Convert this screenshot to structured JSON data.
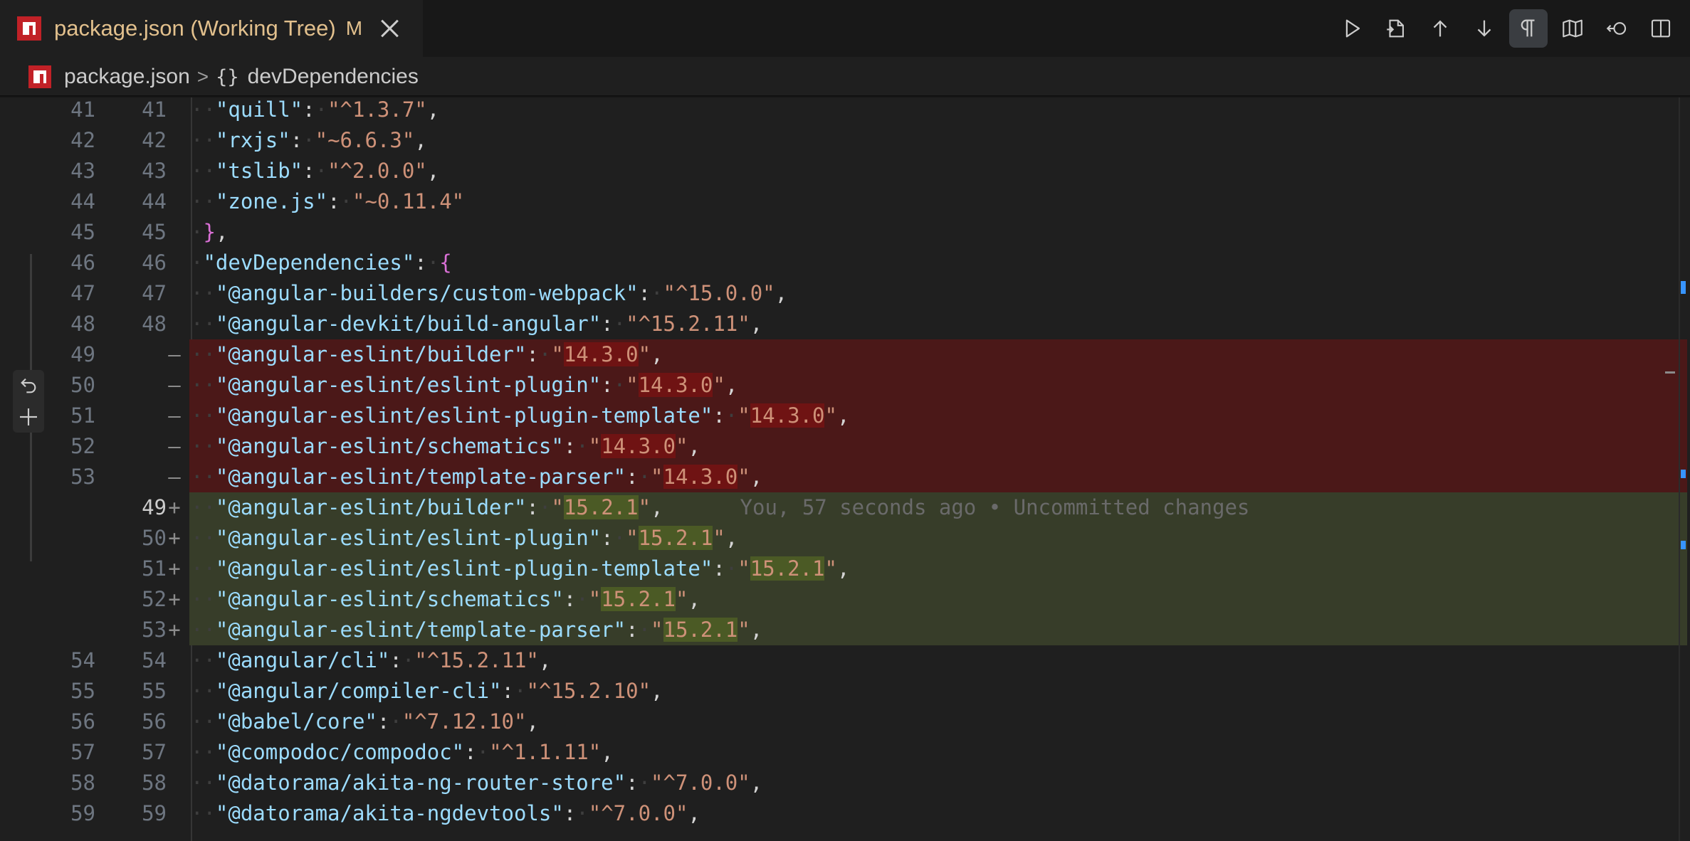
{
  "tab": {
    "title": "package.json (Working Tree)",
    "badge": "M",
    "icon": "npm-icon"
  },
  "toolbar": {
    "buttons": [
      "run-icon",
      "open-file-icon",
      "previous-change-icon",
      "next-change-icon",
      "whitespace-icon",
      "minimap-icon",
      "revert-icon",
      "split-editor-icon"
    ]
  },
  "breadcrumb": {
    "file": "package.json",
    "separator": ">",
    "symbol_icon": "{}",
    "symbol": "devDependencies"
  },
  "editor": {
    "blame": "You, 57 seconds ago • Uncommitted changes",
    "lines": [
      {
        "old": "41",
        "new": "41",
        "mark": "",
        "type": "ctx",
        "indent": 2,
        "key": "\"quill\"",
        "value": "\"^1.3.7\"",
        "trail": ","
      },
      {
        "old": "42",
        "new": "42",
        "mark": "",
        "type": "ctx",
        "indent": 2,
        "key": "\"rxjs\"",
        "value": "\"~6.6.3\"",
        "trail": ","
      },
      {
        "old": "43",
        "new": "43",
        "mark": "",
        "type": "ctx",
        "indent": 2,
        "key": "\"tslib\"",
        "value": "\"^2.0.0\"",
        "trail": ","
      },
      {
        "old": "44",
        "new": "44",
        "mark": "",
        "type": "ctx",
        "indent": 2,
        "key": "\"zone.js\"",
        "value": "\"~0.11.4\"",
        "trail": ""
      },
      {
        "old": "45",
        "new": "45",
        "mark": "",
        "type": "ctx",
        "indent": 1,
        "raw": "}",
        "trail": ","
      },
      {
        "old": "46",
        "new": "46",
        "mark": "",
        "type": "ctx",
        "indent": 1,
        "key": "\"devDependencies\"",
        "open": "{",
        "trail": ""
      },
      {
        "old": "47",
        "new": "47",
        "mark": "",
        "type": "ctx",
        "indent": 2,
        "key": "\"@angular-builders/custom-webpack\"",
        "value": "\"^15.0.0\"",
        "trail": ","
      },
      {
        "old": "48",
        "new": "48",
        "mark": "",
        "type": "ctx",
        "indent": 2,
        "key": "\"@angular-devkit/build-angular\"",
        "value": "\"^15.2.11\"",
        "trail": ","
      },
      {
        "old": "49",
        "new": "",
        "mark": "—",
        "type": "del",
        "indent": 2,
        "key": "\"@angular-eslint/builder\"",
        "value": "\"14.3.0\"",
        "trail": ","
      },
      {
        "old": "50",
        "new": "",
        "mark": "—",
        "type": "del",
        "indent": 2,
        "key": "\"@angular-eslint/eslint-plugin\"",
        "value": "\"14.3.0\"",
        "trail": ","
      },
      {
        "old": "51",
        "new": "",
        "mark": "—",
        "type": "del",
        "indent": 2,
        "key": "\"@angular-eslint/eslint-plugin-template\"",
        "value": "\"14.3.0\"",
        "trail": ","
      },
      {
        "old": "52",
        "new": "",
        "mark": "—",
        "type": "del",
        "indent": 2,
        "key": "\"@angular-eslint/schematics\"",
        "value": "\"14.3.0\"",
        "trail": ","
      },
      {
        "old": "53",
        "new": "",
        "mark": "—",
        "type": "del",
        "indent": 2,
        "key": "\"@angular-eslint/template-parser\"",
        "value": "\"14.3.0\"",
        "trail": ","
      },
      {
        "old": "",
        "new": "49",
        "mark": "+",
        "type": "ins",
        "active": true,
        "indent": 2,
        "key": "\"@angular-eslint/builder\"",
        "value": "\"15.2.1\"",
        "trail": ",",
        "blame": true
      },
      {
        "old": "",
        "new": "50",
        "mark": "+",
        "type": "ins",
        "indent": 2,
        "key": "\"@angular-eslint/eslint-plugin\"",
        "value": "\"15.2.1\"",
        "trail": ","
      },
      {
        "old": "",
        "new": "51",
        "mark": "+",
        "type": "ins",
        "indent": 2,
        "key": "\"@angular-eslint/eslint-plugin-template\"",
        "value": "\"15.2.1\"",
        "trail": ","
      },
      {
        "old": "",
        "new": "52",
        "mark": "+",
        "type": "ins",
        "indent": 2,
        "key": "\"@angular-eslint/schematics\"",
        "value": "\"15.2.1\"",
        "trail": ","
      },
      {
        "old": "",
        "new": "53",
        "mark": "+",
        "type": "ins",
        "indent": 2,
        "key": "\"@angular-eslint/template-parser\"",
        "value": "\"15.2.1\"",
        "trail": ","
      },
      {
        "old": "54",
        "new": "54",
        "mark": "",
        "type": "ctx",
        "indent": 2,
        "key": "\"@angular/cli\"",
        "value": "\"^15.2.11\"",
        "trail": ","
      },
      {
        "old": "55",
        "new": "55",
        "mark": "",
        "type": "ctx",
        "indent": 2,
        "key": "\"@angular/compiler-cli\"",
        "value": "\"^15.2.10\"",
        "trail": ","
      },
      {
        "old": "56",
        "new": "56",
        "mark": "",
        "type": "ctx",
        "indent": 2,
        "key": "\"@babel/core\"",
        "value": "\"^7.12.10\"",
        "trail": ","
      },
      {
        "old": "57",
        "new": "57",
        "mark": "",
        "type": "ctx",
        "indent": 2,
        "key": "\"@compodoc/compodoc\"",
        "value": "\"^1.1.11\"",
        "trail": ","
      },
      {
        "old": "58",
        "new": "58",
        "mark": "",
        "type": "ctx",
        "indent": 2,
        "key": "\"@datorama/akita-ng-router-store\"",
        "value": "\"^7.0.0\"",
        "trail": ","
      },
      {
        "old": "59",
        "new": "59",
        "mark": "",
        "type": "ctx",
        "indent": 2,
        "key": "\"@datorama/akita-ngdevtools\"",
        "value": "\"^7.0.0\"",
        "trail": ","
      }
    ]
  }
}
